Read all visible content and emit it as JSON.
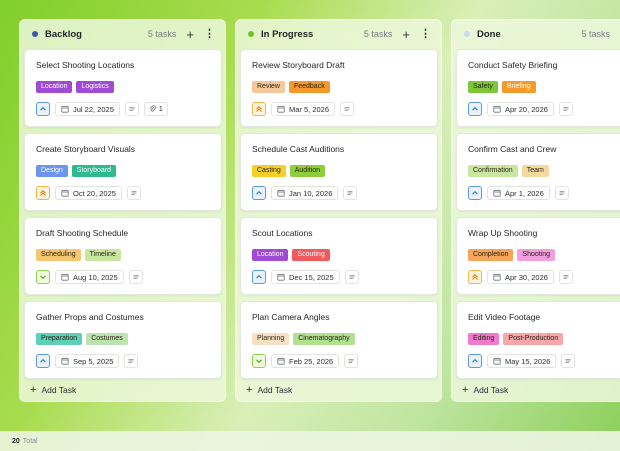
{
  "columns": [
    {
      "title": "Backlog",
      "count": "5 tasks",
      "dot_color": "#3a5aa8",
      "add_task_label": "Add Task",
      "cards": [
        {
          "title": "Select Shooting Locations",
          "tags": [
            {
              "label": "Location",
              "color": "#a04bd6"
            },
            {
              "label": "Logistics",
              "color": "#a04bd6"
            }
          ],
          "priority": "medium",
          "date": "Jul 22, 2025",
          "attachments": "1"
        },
        {
          "title": "Create Storyboard Visuals",
          "tags": [
            {
              "label": "Design",
              "color": "#6b95ee"
            },
            {
              "label": "Storyboard",
              "color": "#2fba8e"
            }
          ],
          "priority": "high",
          "date": "Oct 20, 2025"
        },
        {
          "title": "Draft Shooting Schedule",
          "tags": [
            {
              "label": "Scheduling",
              "color": "#f5c770"
            },
            {
              "label": "Timeline",
              "color": "#c8e6a0"
            }
          ],
          "priority": "low",
          "date": "Aug 10, 2025"
        },
        {
          "title": "Gather Props and Costumes",
          "tags": [
            {
              "label": "Preparation",
              "color": "#5fd0b8"
            },
            {
              "label": "Costumes",
              "color": "#bde4b0"
            }
          ],
          "priority": "medium",
          "date": "Sep 5, 2025"
        }
      ]
    },
    {
      "title": "In Progress",
      "count": "5 tasks",
      "dot_color": "#6fc21f",
      "add_task_label": "Add Task",
      "cards": [
        {
          "title": "Review Storyboard Draft",
          "tags": [
            {
              "label": "Review",
              "color": "#f6c79a"
            },
            {
              "label": "Feedback",
              "color": "#f59a2a"
            }
          ],
          "priority": "high",
          "date": "Mar 5, 2026"
        },
        {
          "title": "Schedule Cast Auditions",
          "tags": [
            {
              "label": "Casting",
              "color": "#f5cf2a"
            },
            {
              "label": "Audition",
              "color": "#8ccf3a"
            }
          ],
          "priority": "medium",
          "date": "Jan 10, 2026"
        },
        {
          "title": "Scout Locations",
          "tags": [
            {
              "label": "Location",
              "color": "#a04bd6"
            },
            {
              "label": "Scouting",
              "color": "#ef5a5a"
            }
          ],
          "priority": "medium",
          "date": "Dec 15, 2025"
        },
        {
          "title": "Plan Camera Angles",
          "tags": [
            {
              "label": "Planning",
              "color": "#f7e0c4"
            },
            {
              "label": "Cinematography",
              "color": "#b0e090"
            }
          ],
          "priority": "low",
          "date": "Feb 25, 2026"
        }
      ]
    },
    {
      "title": "Done",
      "count": "5 tasks",
      "dot_color": "#c8dcef",
      "add_task_label": "Add Task",
      "cards": [
        {
          "title": "Conduct Safety Briefing",
          "tags": [
            {
              "label": "Safety",
              "color": "#7cc83a"
            },
            {
              "label": "Briefing",
              "color": "#f59a2a"
            }
          ],
          "priority": "medium",
          "date": "Apr 20, 2026"
        },
        {
          "title": "Confirm Cast and Crew",
          "tags": [
            {
              "label": "Confirmation",
              "color": "#c8e6a0"
            },
            {
              "label": "Team",
              "color": "#f6d9a0"
            }
          ],
          "priority": "medium",
          "date": "Apr 1, 2026"
        },
        {
          "title": "Wrap Up Shooting",
          "tags": [
            {
              "label": "Completion",
              "color": "#f5a65a"
            },
            {
              "label": "Shooting",
              "color": "#f29fe0"
            }
          ],
          "priority": "high",
          "date": "Apr 30, 2026"
        },
        {
          "title": "Edit Video Footage",
          "tags": [
            {
              "label": "Editing",
              "color": "#f07acb"
            },
            {
              "label": "Post-Production",
              "color": "#f6a7a7"
            }
          ],
          "priority": "medium",
          "date": "May 15, 2026"
        }
      ]
    }
  ],
  "footer": {
    "total_count": "20",
    "total_label": "Total"
  }
}
